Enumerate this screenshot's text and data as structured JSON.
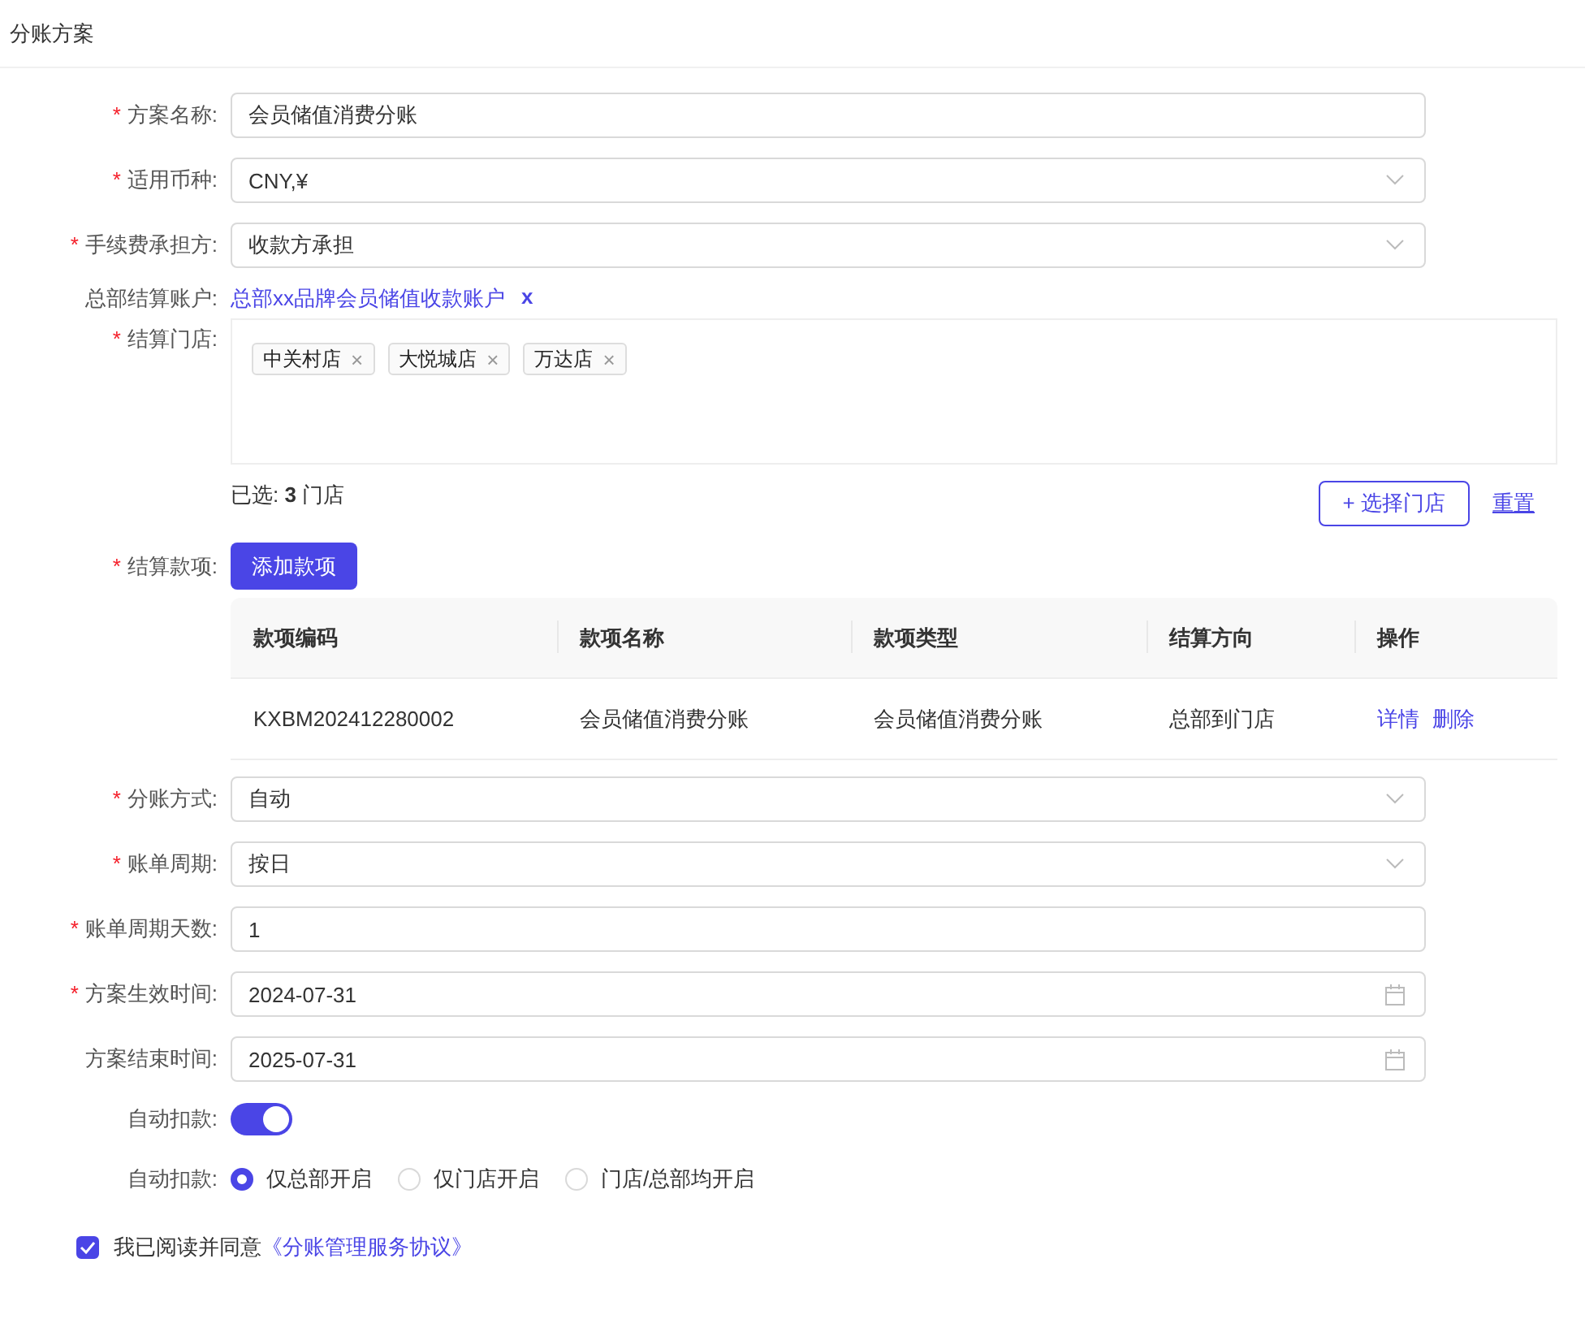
{
  "title": "分账方案",
  "fields_top": [
    {
      "label": "方案名称:",
      "required_mark": "*",
      "kind": "text",
      "value": "会员储值消费分账"
    },
    {
      "label": "适用币种:",
      "required_mark": "*",
      "kind": "select",
      "value": "CNY,¥"
    },
    {
      "label": "手续费承担方:",
      "required_mark": "*",
      "kind": "select",
      "value": "收款方承担"
    }
  ],
  "account": {
    "label": "总部结算账户:",
    "value": "总部xx品牌会员储值收款账户",
    "remove": "x"
  },
  "stores": {
    "label": "结算门店:",
    "required_mark": "*",
    "tags": [
      {
        "name": "中关村店",
        "remove": "×"
      },
      {
        "name": "大悦城店",
        "remove": "×"
      },
      {
        "name": "万达店",
        "remove": "×"
      }
    ],
    "summary": "已选: **3** 门店",
    "select_button": "+ 选择门店",
    "reset_link": "重置"
  },
  "items": {
    "label": "结算款项:",
    "required_mark": "*",
    "add_button": "添加款项",
    "columns": [
      "款项编码",
      "款项名称",
      "款项类型",
      "结算方向",
      "操作"
    ],
    "rows": [
      {
        "cells": [
          "KXBM202412280002",
          "会员储值消费分账",
          "会员储值消费分账",
          "总部到门店"
        ],
        "actions": [
          "详情",
          "删除"
        ]
      }
    ]
  },
  "fields_bottom": [
    {
      "label": "分账方式:",
      "required_mark": "*",
      "kind": "select",
      "value": "自动"
    },
    {
      "label": "账单周期:",
      "required_mark": "*",
      "kind": "select",
      "value": "按日"
    },
    {
      "label": "账单周期天数:",
      "required_mark": "*",
      "kind": "text",
      "value": "1"
    },
    {
      "label": "方案生效时间:",
      "required_mark": "*",
      "kind": "date",
      "value": "2024-07-31"
    },
    {
      "label": "方案结束时间:",
      "kind": "date",
      "value": "2025-07-31"
    }
  ],
  "auto_deduct": {
    "label": "自动扣款:",
    "on": true
  },
  "deduct_scope": {
    "label": "自动扣款:",
    "options": [
      {
        "label": "仅总部开启",
        "selected": true
      },
      {
        "label": "仅门店开启",
        "selected": false
      },
      {
        "label": "门店/总部均开启",
        "selected": false
      }
    ]
  },
  "agreement": {
    "checked": true,
    "text": "我已阅读并同意",
    "link": "《分账管理服务协议》"
  }
}
